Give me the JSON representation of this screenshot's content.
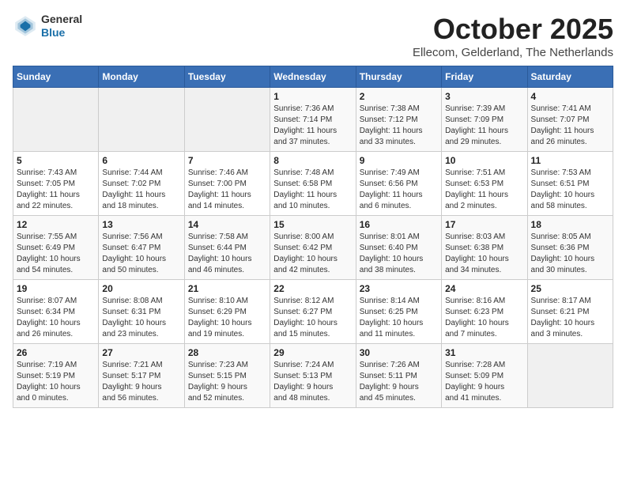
{
  "header": {
    "logo_general": "General",
    "logo_blue": "Blue",
    "title": "October 2025",
    "subtitle": "Ellecom, Gelderland, The Netherlands"
  },
  "columns": [
    "Sunday",
    "Monday",
    "Tuesday",
    "Wednesday",
    "Thursday",
    "Friday",
    "Saturday"
  ],
  "weeks": [
    [
      {
        "day": "",
        "info": ""
      },
      {
        "day": "",
        "info": ""
      },
      {
        "day": "",
        "info": ""
      },
      {
        "day": "1",
        "info": "Sunrise: 7:36 AM\nSunset: 7:14 PM\nDaylight: 11 hours\nand 37 minutes."
      },
      {
        "day": "2",
        "info": "Sunrise: 7:38 AM\nSunset: 7:12 PM\nDaylight: 11 hours\nand 33 minutes."
      },
      {
        "day": "3",
        "info": "Sunrise: 7:39 AM\nSunset: 7:09 PM\nDaylight: 11 hours\nand 29 minutes."
      },
      {
        "day": "4",
        "info": "Sunrise: 7:41 AM\nSunset: 7:07 PM\nDaylight: 11 hours\nand 26 minutes."
      }
    ],
    [
      {
        "day": "5",
        "info": "Sunrise: 7:43 AM\nSunset: 7:05 PM\nDaylight: 11 hours\nand 22 minutes."
      },
      {
        "day": "6",
        "info": "Sunrise: 7:44 AM\nSunset: 7:02 PM\nDaylight: 11 hours\nand 18 minutes."
      },
      {
        "day": "7",
        "info": "Sunrise: 7:46 AM\nSunset: 7:00 PM\nDaylight: 11 hours\nand 14 minutes."
      },
      {
        "day": "8",
        "info": "Sunrise: 7:48 AM\nSunset: 6:58 PM\nDaylight: 11 hours\nand 10 minutes."
      },
      {
        "day": "9",
        "info": "Sunrise: 7:49 AM\nSunset: 6:56 PM\nDaylight: 11 hours\nand 6 minutes."
      },
      {
        "day": "10",
        "info": "Sunrise: 7:51 AM\nSunset: 6:53 PM\nDaylight: 11 hours\nand 2 minutes."
      },
      {
        "day": "11",
        "info": "Sunrise: 7:53 AM\nSunset: 6:51 PM\nDaylight: 10 hours\nand 58 minutes."
      }
    ],
    [
      {
        "day": "12",
        "info": "Sunrise: 7:55 AM\nSunset: 6:49 PM\nDaylight: 10 hours\nand 54 minutes."
      },
      {
        "day": "13",
        "info": "Sunrise: 7:56 AM\nSunset: 6:47 PM\nDaylight: 10 hours\nand 50 minutes."
      },
      {
        "day": "14",
        "info": "Sunrise: 7:58 AM\nSunset: 6:44 PM\nDaylight: 10 hours\nand 46 minutes."
      },
      {
        "day": "15",
        "info": "Sunrise: 8:00 AM\nSunset: 6:42 PM\nDaylight: 10 hours\nand 42 minutes."
      },
      {
        "day": "16",
        "info": "Sunrise: 8:01 AM\nSunset: 6:40 PM\nDaylight: 10 hours\nand 38 minutes."
      },
      {
        "day": "17",
        "info": "Sunrise: 8:03 AM\nSunset: 6:38 PM\nDaylight: 10 hours\nand 34 minutes."
      },
      {
        "day": "18",
        "info": "Sunrise: 8:05 AM\nSunset: 6:36 PM\nDaylight: 10 hours\nand 30 minutes."
      }
    ],
    [
      {
        "day": "19",
        "info": "Sunrise: 8:07 AM\nSunset: 6:34 PM\nDaylight: 10 hours\nand 26 minutes."
      },
      {
        "day": "20",
        "info": "Sunrise: 8:08 AM\nSunset: 6:31 PM\nDaylight: 10 hours\nand 23 minutes."
      },
      {
        "day": "21",
        "info": "Sunrise: 8:10 AM\nSunset: 6:29 PM\nDaylight: 10 hours\nand 19 minutes."
      },
      {
        "day": "22",
        "info": "Sunrise: 8:12 AM\nSunset: 6:27 PM\nDaylight: 10 hours\nand 15 minutes."
      },
      {
        "day": "23",
        "info": "Sunrise: 8:14 AM\nSunset: 6:25 PM\nDaylight: 10 hours\nand 11 minutes."
      },
      {
        "day": "24",
        "info": "Sunrise: 8:16 AM\nSunset: 6:23 PM\nDaylight: 10 hours\nand 7 minutes."
      },
      {
        "day": "25",
        "info": "Sunrise: 8:17 AM\nSunset: 6:21 PM\nDaylight: 10 hours\nand 3 minutes."
      }
    ],
    [
      {
        "day": "26",
        "info": "Sunrise: 7:19 AM\nSunset: 5:19 PM\nDaylight: 10 hours\nand 0 minutes."
      },
      {
        "day": "27",
        "info": "Sunrise: 7:21 AM\nSunset: 5:17 PM\nDaylight: 9 hours\nand 56 minutes."
      },
      {
        "day": "28",
        "info": "Sunrise: 7:23 AM\nSunset: 5:15 PM\nDaylight: 9 hours\nand 52 minutes."
      },
      {
        "day": "29",
        "info": "Sunrise: 7:24 AM\nSunset: 5:13 PM\nDaylight: 9 hours\nand 48 minutes."
      },
      {
        "day": "30",
        "info": "Sunrise: 7:26 AM\nSunset: 5:11 PM\nDaylight: 9 hours\nand 45 minutes."
      },
      {
        "day": "31",
        "info": "Sunrise: 7:28 AM\nSunset: 5:09 PM\nDaylight: 9 hours\nand 41 minutes."
      },
      {
        "day": "",
        "info": ""
      }
    ]
  ]
}
